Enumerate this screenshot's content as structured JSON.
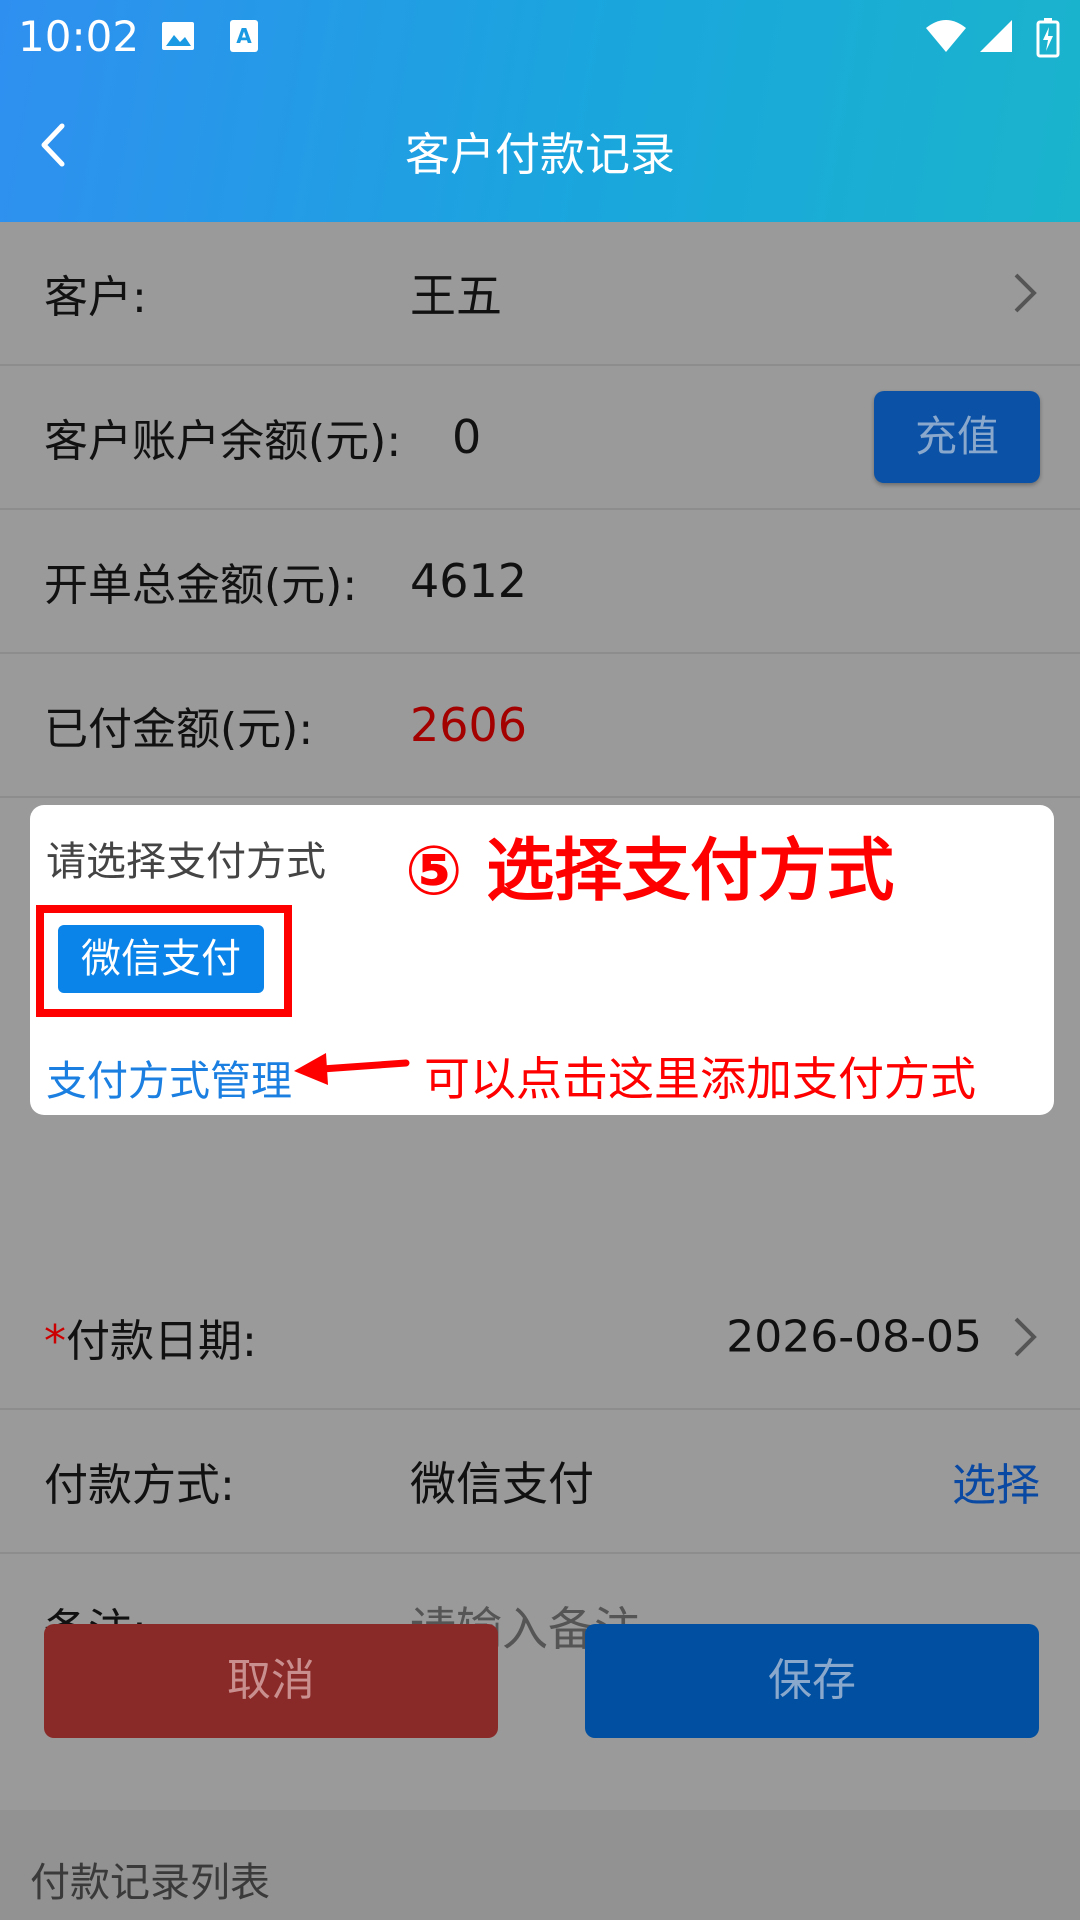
{
  "status_bar": {
    "time": "10:02"
  },
  "header": {
    "title": "客户付款记录"
  },
  "form": {
    "customer": {
      "label": "客户:",
      "value": "王五"
    },
    "balance": {
      "label": "客户账户余额(元):",
      "value": "0",
      "button": "充值"
    },
    "total": {
      "label": "开单总金额(元):",
      "value": "4612"
    },
    "paid": {
      "label": "已付金额(元):",
      "value": "2606"
    },
    "pay_date": {
      "required_mark": "*",
      "label": "付款日期:",
      "value": "2026-08-05"
    },
    "pay_method": {
      "label": "付款方式:",
      "value": "微信支付",
      "link": "选择"
    },
    "remark": {
      "label": "备注:",
      "placeholder": "请输入备注"
    }
  },
  "buttons": {
    "cancel": "取消",
    "save": "保存"
  },
  "list": {
    "title": "付款记录列表"
  },
  "modal": {
    "title": "请选择支付方式",
    "option": "微信支付",
    "manage_link": "支付方式管理"
  },
  "annotations": {
    "step_title": "⑤ 选择支付方式",
    "tip": "可以点击这里添加支付方式"
  },
  "colors": {
    "accent": "#1a7fe0",
    "annotation": "#ff0000"
  }
}
